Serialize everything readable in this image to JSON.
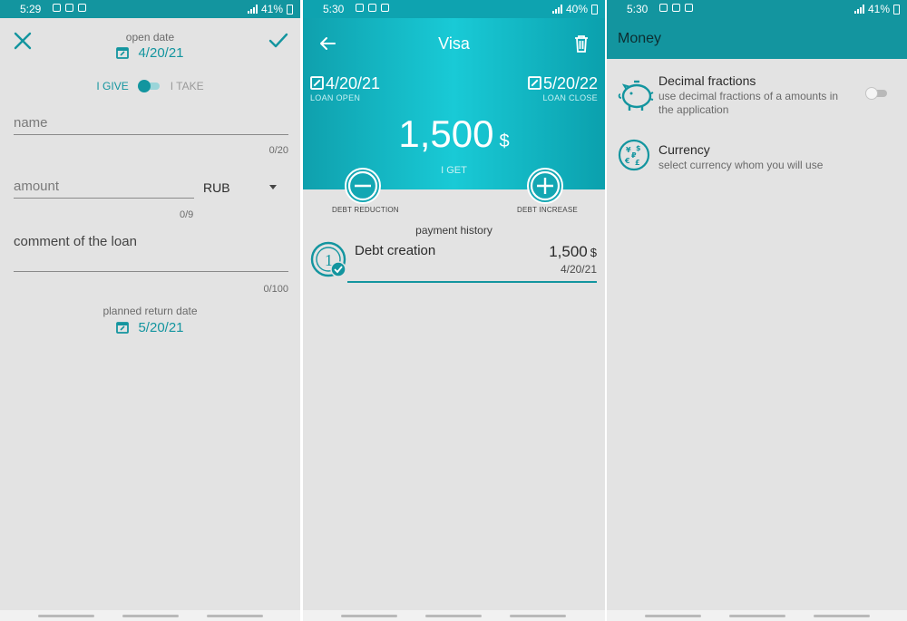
{
  "screens": [
    {
      "status": {
        "time": "5:29",
        "battery": "41%"
      },
      "open_date_label": "open date",
      "open_date": "4/20/21",
      "give_label": "I GIVE",
      "take_label": "I TAKE",
      "name_placeholder": "name",
      "name_counter": "0/20",
      "amount_placeholder": "amount",
      "currency": "RUB",
      "amount_counter": "0/9",
      "comment_placeholder": "comment of the loan",
      "comment_counter": "0/100",
      "return_date_label": "planned return date",
      "return_date": "5/20/21"
    },
    {
      "status": {
        "time": "5:30",
        "battery": "40%"
      },
      "title": "Visa",
      "loan_open_date": "4/20/21",
      "loan_open_label": "LOAN OPEN",
      "loan_close_date": "5/20/22",
      "loan_close_label": "LOAN CLOSE",
      "amount": "1,500",
      "currency_symbol": "$",
      "direction": "I GET",
      "debt_reduction_label": "DEBT REDUCTION",
      "debt_increase_label": "DEBT INCREASE",
      "payment_history_label": "payment history",
      "history": [
        {
          "title": "Debt creation",
          "amount": "1,500",
          "currency": "$",
          "date": "4/20/21",
          "index": "1"
        }
      ]
    },
    {
      "status": {
        "time": "5:30",
        "battery": "41%"
      },
      "title": "Money",
      "settings": [
        {
          "title": "Decimal fractions",
          "description": "use decimal fractions of a amounts in the application",
          "icon": "piggy-bank-icon",
          "enabled": false
        },
        {
          "title": "Currency",
          "description": "select currency whom you will use",
          "icon": "currency-coin-icon"
        }
      ]
    }
  ],
  "colors": {
    "accent": "#13959f",
    "header_gradient_mid": "#19cad6",
    "background": "#e3e3e3"
  }
}
